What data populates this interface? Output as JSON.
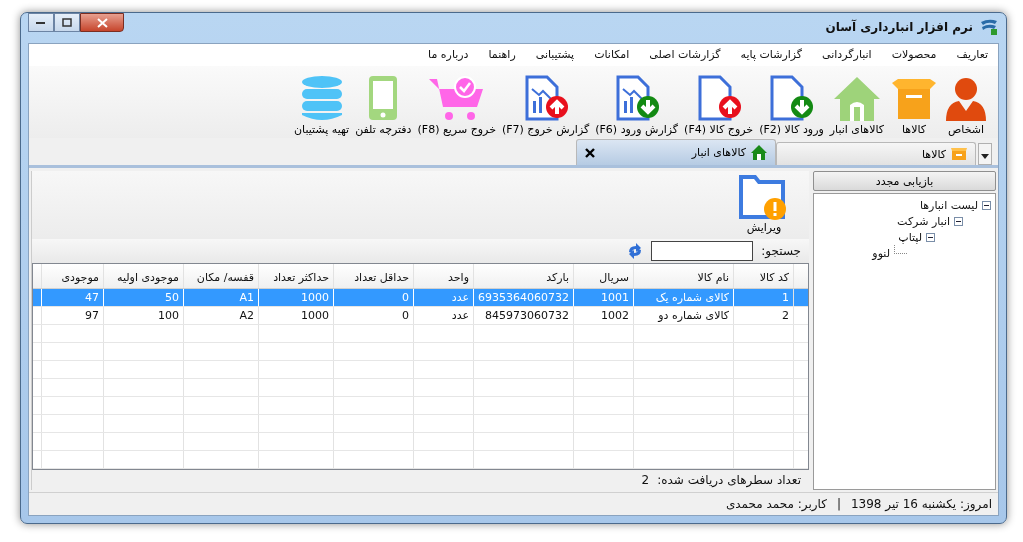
{
  "window": {
    "title": "نرم افزار انبارداری آسان"
  },
  "menu": [
    "تعاریف",
    "محصولات",
    "انبارگردانی",
    "گزارشات پایه",
    "گزارشات اصلی",
    "امکانات",
    "پشتیبانی",
    "راهنما",
    "درباره ما"
  ],
  "toolbar": [
    {
      "label": "اشخاص"
    },
    {
      "label": "کالاها"
    },
    {
      "label": "کالاهای انبار"
    },
    {
      "label": "ورود کالا (F2)"
    },
    {
      "label": "خروج کالا (F4)"
    },
    {
      "label": "گزارش ورود (F6)"
    },
    {
      "label": "گزارش خروج (F7)"
    },
    {
      "label": "خروج سریع (F8)"
    },
    {
      "label": "دفترچه تلفن"
    },
    {
      "label": "تهیه پشتیبان"
    }
  ],
  "tabs": [
    {
      "label": "کالاها",
      "selected": false
    },
    {
      "label": "کالاهای انبار",
      "selected": true
    }
  ],
  "sidebar": {
    "refresh_button": "بازیابی مجدد",
    "tree": [
      {
        "label": "لیست انبارها",
        "expanded": true,
        "children": [
          {
            "label": "انبار شرکت",
            "expanded": true,
            "children": [
              {
                "label": "لپتاپ",
                "expanded": true,
                "children": [
                  {
                    "label": "لنوو"
                  }
                ]
              }
            ]
          }
        ]
      }
    ]
  },
  "edit_button": "ویرایش",
  "search": {
    "label": "جستجو:"
  },
  "table": {
    "columns": [
      "کد کالا",
      "نام کالا",
      "سریال",
      "بارکد",
      "واحد",
      "حداقل تعداد",
      "حداکثر تعداد",
      "قفسه/ مکان",
      "موجودی اولیه",
      "موجودی"
    ],
    "rows": [
      {
        "selected": true,
        "cells": [
          "1",
          "کالای شماره یک",
          "1001",
          "6935364060732",
          "عدد",
          "0",
          "1000",
          "A1",
          "50",
          "47"
        ]
      },
      {
        "selected": false,
        "cells": [
          "2",
          "کالای شماره دو",
          "1002",
          "845973060732",
          "عدد",
          "0",
          "1000",
          "A2",
          "100",
          "97"
        ]
      }
    ]
  },
  "row_count": {
    "label": "تعداد سطرهای دریافت شده:",
    "value": "2"
  },
  "status_bar": {
    "date": "امروز: یکشنبه 16 تیر 1398",
    "separator": "|",
    "user": "کاربر: محمد محمدی"
  }
}
